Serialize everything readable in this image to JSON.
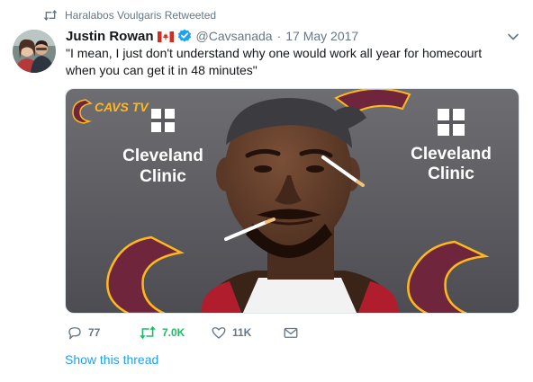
{
  "retweet_context": {
    "text": "Haralabos Voulgaris Retweeted"
  },
  "tweet": {
    "author_name": "Justin Rowan",
    "flag_icon": "canada-flag-icon",
    "verified_icon": "verified-badge-icon",
    "handle": "@Cavsanada",
    "separator": "·",
    "date": "17 May 2017",
    "text": "\"I mean, I just don't understand why one would work all year for homecourt when you can get it in 48 minutes\""
  },
  "media": {
    "backdrop_labels": {
      "network": "CAVS TV",
      "sponsor_left_line1": "Cleveland",
      "sponsor_left_line2": "Clinic",
      "sponsor_right_line1": "Cleveland",
      "sponsor_right_line2": "Clinic"
    }
  },
  "actions": {
    "replies": "77",
    "retweets": "7.0K",
    "likes": "11K"
  },
  "footer": {
    "show_thread": "Show this thread"
  },
  "colors": {
    "accent": "#1da1f2",
    "retweet_green": "#17bf63",
    "muted": "#657786",
    "cavs_wine": "#6f263d",
    "cavs_gold": "#ffb81c"
  }
}
